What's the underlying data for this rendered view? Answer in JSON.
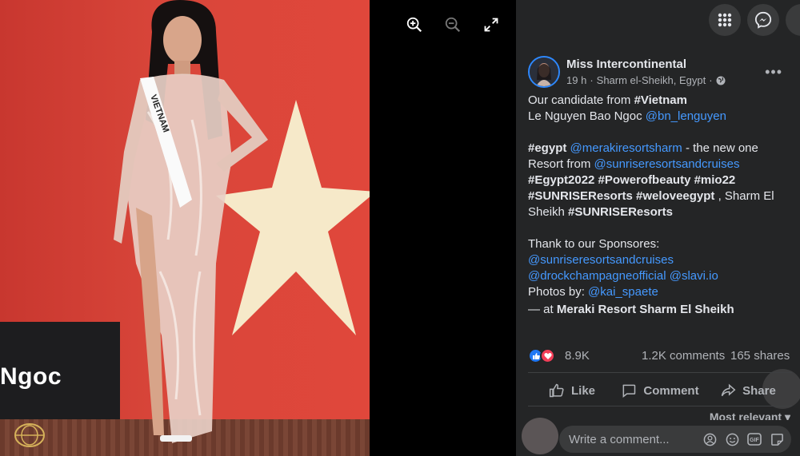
{
  "photo": {
    "sign_text": "Ngoc",
    "sash_text": "VIETNAM"
  },
  "viewer": {
    "icons": [
      "zoom-in-icon",
      "zoom-out-icon",
      "fullscreen-icon"
    ]
  },
  "topbar": {
    "icons": [
      "menu-grid-icon",
      "messenger-icon"
    ]
  },
  "post": {
    "page_name": "Miss Intercontinental",
    "time": "19 h",
    "location": "Sharm el-Sheikh, Egypt",
    "privacy_icon": "globe-icon",
    "body": {
      "l1_text": "Our candidate from ",
      "l1_tag": "#Vietnam",
      "l2_text": "Le Nguyen Bao Ngoc ",
      "l2_mention": "@bn_lenguyen",
      "p2_tag1": "#egypt",
      "p2_mention1": "@merakiresortsharm",
      "p2_text1": " - the new one Resort from ",
      "p2_mention2": "@sunriseresortsandcruises",
      "p2_tags2": "#Egypt2022 #Powerofbeauty #mio22 #SUNRISEResorts #weloveegypt",
      "p2_text2": " , Sharm El Sheikh ",
      "p2_tag3": "#SUNRISEResorts",
      "p3_text": "Thank to our Sponsores:",
      "p3_mention1": "@sunriseresortsandcruises",
      "p3_mention2": "@drockchampagneofficial",
      "p3_mention3": "@slavi.io",
      "p3_photos": "Photos by: ",
      "p3_mention4": "@kai_spaete",
      "at_text": "— at ",
      "at_place": "Meraki Resort Sharm El Sheikh"
    },
    "stats": {
      "reactions": "8.9K",
      "comments": "1.2K comments",
      "shares": "165 shares"
    },
    "actions": {
      "like": "Like",
      "comment": "Comment",
      "share": "Share"
    },
    "sort_label": "Most relevant",
    "comment_placeholder": "Write a comment...",
    "comment_icons": [
      "avatar-sticker-icon",
      "emoji-icon",
      "gif-icon",
      "sticker-icon"
    ]
  },
  "colors": {
    "panel_bg": "#242526",
    "link": "#4599ff",
    "like_blue": "#2078f4",
    "love_red": "#f33e58"
  }
}
